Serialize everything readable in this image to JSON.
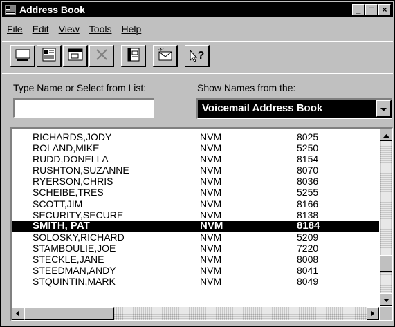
{
  "window": {
    "title": "Address Book",
    "buttons": [
      "_",
      "□",
      "×"
    ]
  },
  "menu": [
    {
      "label": "File",
      "name": "menu-file"
    },
    {
      "label": "Edit",
      "name": "menu-edit"
    },
    {
      "label": "View",
      "name": "menu-view"
    },
    {
      "label": "Tools",
      "name": "menu-tools"
    },
    {
      "label": "Help",
      "name": "menu-help"
    }
  ],
  "toolbar": {
    "buttons": [
      "new-entry-icon",
      "properties-card-icon",
      "properties-icon",
      "delete-icon",
      "address-book-icon",
      "new-message-icon",
      "help-pointer-icon"
    ],
    "help_glyph": "?"
  },
  "search": {
    "label": "Type Name or Select from List:",
    "value": ""
  },
  "source": {
    "label": "Show Names from the:",
    "selected": "Voicemail Address Book"
  },
  "entries": [
    {
      "name": "RICHARDS,JODY",
      "type": "NVM",
      "ext": "8025"
    },
    {
      "name": "ROLAND,MIKE",
      "type": "NVM",
      "ext": "5250"
    },
    {
      "name": "RUDD,DONELLA",
      "type": "NVM",
      "ext": "8154"
    },
    {
      "name": "RUSHTON,SUZANNE",
      "type": "NVM",
      "ext": "8070"
    },
    {
      "name": "RYERSON,CHRIS",
      "type": "NVM",
      "ext": "8036"
    },
    {
      "name": "SCHEIBE,TRES",
      "type": "NVM",
      "ext": "5255"
    },
    {
      "name": "SCOTT,JIM",
      "type": "NVM",
      "ext": "8166"
    },
    {
      "name": "SECURITY,SECURE",
      "type": "NVM",
      "ext": "8138"
    },
    {
      "name": "SMITH, PAT",
      "type": "NVM",
      "ext": "8184",
      "selected": true
    },
    {
      "name": "SOLOSKY,RICHARD",
      "type": "NVM",
      "ext": "5209"
    },
    {
      "name": "STAMBOULIE,JOE",
      "type": "NVM",
      "ext": "7220"
    },
    {
      "name": "STECKLE,JANE",
      "type": "NVM",
      "ext": "8008"
    },
    {
      "name": "STEEDMAN,ANDY",
      "type": "NVM",
      "ext": "8041"
    },
    {
      "name": "STQUINTIN,MARK",
      "type": "NVM",
      "ext": "8049"
    }
  ]
}
